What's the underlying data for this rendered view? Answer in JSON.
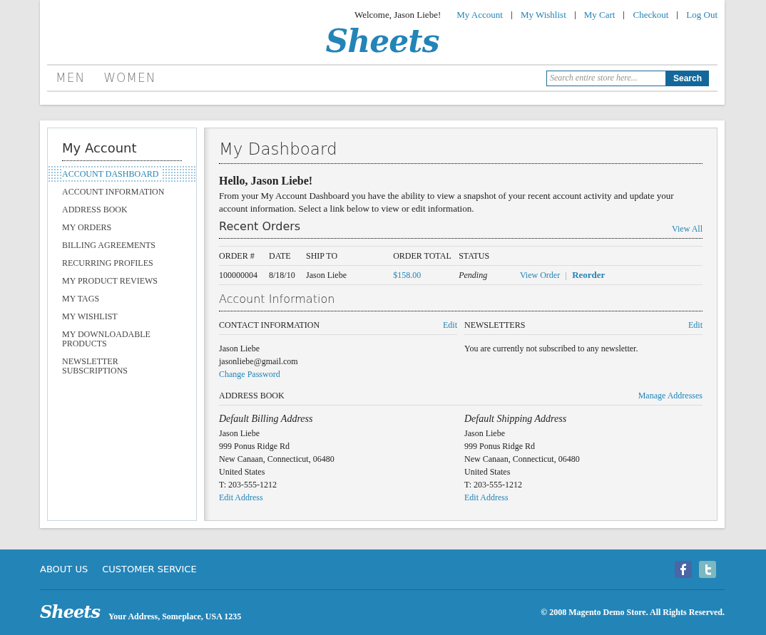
{
  "header": {
    "welcome": "Welcome, Jason Liebe!",
    "links": [
      "My Account",
      "My Wishlist",
      "My Cart",
      "Checkout",
      "Log Out"
    ],
    "logo": "Sheets"
  },
  "nav": {
    "items": [
      "MEN",
      "WOMEN"
    ],
    "search": {
      "placeholder": "Search entire store here...",
      "button": "Search"
    }
  },
  "sidebar": {
    "title": "My Account",
    "items": [
      {
        "label": "ACCOUNT DASHBOARD",
        "selected": true
      },
      {
        "label": "ACCOUNT INFORMATION",
        "selected": false
      },
      {
        "label": "ADDRESS BOOK",
        "selected": false
      },
      {
        "label": "MY ORDERS",
        "selected": false
      },
      {
        "label": "BILLING AGREEMENTS",
        "selected": false
      },
      {
        "label": "RECURRING PROFILES",
        "selected": false
      },
      {
        "label": "MY PRODUCT REVIEWS",
        "selected": false
      },
      {
        "label": "MY TAGS",
        "selected": false
      },
      {
        "label": "MY WISHLIST",
        "selected": false
      },
      {
        "label": "MY DOWNLOADABLE PRODUCTS",
        "selected": false
      },
      {
        "label": "NEWSLETTER SUBSCRIPTIONS",
        "selected": false
      }
    ]
  },
  "dashboard": {
    "title": "My Dashboard",
    "greeting": "Hello, Jason Liebe!",
    "intro": "From your My Account Dashboard you have the ability to view a snapshot of your recent account activity and update your account information. Select a link below to view or edit information.",
    "recent_orders": {
      "title": "Recent Orders",
      "view_all": "View All",
      "columns": [
        "ORDER #",
        "DATE",
        "SHIP TO",
        "ORDER TOTAL",
        "STATUS"
      ],
      "rows": [
        {
          "order": "100000004",
          "date": "8/18/10",
          "ship_to": "Jason Liebe",
          "total": "$158.00",
          "status": "Pending",
          "view": "View Order",
          "reorder": "Reorder"
        }
      ]
    },
    "account_info": {
      "title": "Account Information",
      "contact": {
        "heading": "CONTACT INFORMATION",
        "edit": "Edit",
        "lines": [
          "Jason Liebe",
          "jasonliebe@gmail.com"
        ],
        "change_password": "Change Password"
      },
      "newsletters": {
        "heading": "NEWSLETTERS",
        "edit": "Edit",
        "text": "You are currently not subscribed to any newsletter."
      },
      "address_book": {
        "heading": "ADDRESS BOOK",
        "manage": "Manage Addresses",
        "addresses": [
          {
            "title": "Default Billing Address",
            "lines": [
              "Jason Liebe",
              "999 Ponus Ridge Rd",
              "New Canaan, Connecticut, 06480",
              "United States",
              "T: 203-555-1212"
            ],
            "edit": "Edit Address"
          },
          {
            "title": "Default Shipping Address",
            "lines": [
              "Jason Liebe",
              "999 Ponus Ridge Rd",
              "New Canaan, Connecticut, 06480",
              "United States",
              "T: 203-555-1212"
            ],
            "edit": "Edit Address"
          }
        ]
      }
    }
  },
  "footer": {
    "links": [
      "ABOUT US",
      "CUSTOMER SERVICE"
    ],
    "logo": "Sheets",
    "address": "Your Address, Someplace, USA 1235",
    "copyright": "© 2008 Magento Demo Store. All Rights Reserved."
  }
}
